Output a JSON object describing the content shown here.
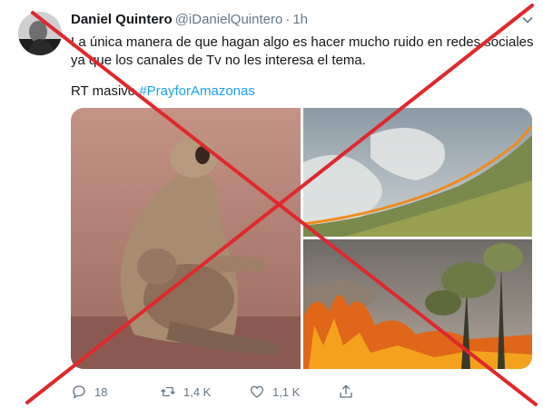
{
  "tweet": {
    "display_name": "Daniel Quintero",
    "handle": "@iDanielQuintero",
    "separator": "·",
    "time": "1h",
    "text_line1": "La única manera de que hagan algo es hacer mucho ruido en redes sociales",
    "text_line2": "ya que los canales de Tv no les interesa el tema.",
    "rt_prefix": "RT masivo ",
    "hashtag": "#PrayforAmazonas",
    "replies": "18",
    "retweets": "1,4 K",
    "likes": "1,1 K"
  },
  "icons": {
    "reply": "reply-icon",
    "retweet": "retweet-icon",
    "like": "heart-icon",
    "share": "share-icon",
    "more": "chevron-down-icon"
  },
  "colors": {
    "hashtag": "#1da1f2",
    "secondary_text": "#657786",
    "cross": "#e0282d"
  }
}
